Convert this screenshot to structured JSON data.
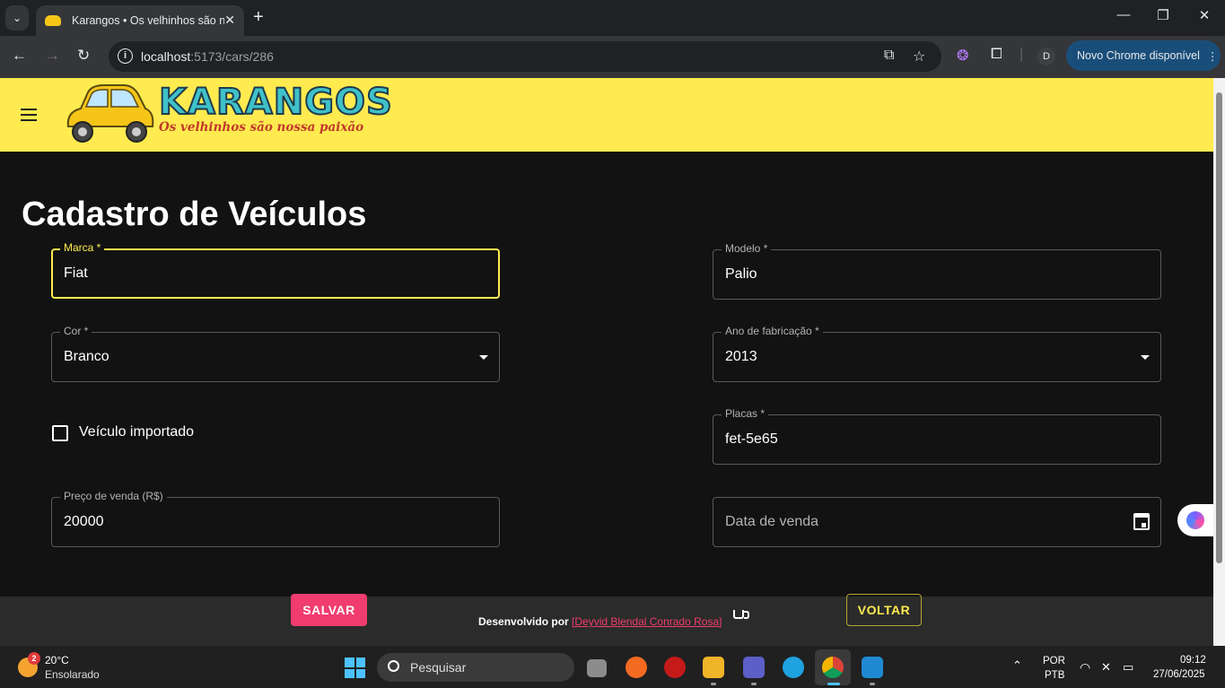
{
  "browser": {
    "tab_title": "Karangos • Os velhinhos são nossa paixão",
    "url_host": "localhost",
    "url_path": ":5173/cars/286",
    "update_label": "Novo Chrome disponível",
    "profile_initial": "D"
  },
  "app": {
    "logo_title": "KARANGOS",
    "logo_subtitle": "Os velhinhos são nossa paixão"
  },
  "form": {
    "title": "Cadastro de Veículos",
    "marca": {
      "label": "Marca *",
      "value": "Fiat"
    },
    "modelo": {
      "label": "Modelo *",
      "value": "Palio"
    },
    "cor": {
      "label": "Cor *",
      "value": "Branco"
    },
    "ano": {
      "label": "Ano de fabricação *",
      "value": "2013"
    },
    "importado": {
      "label": "Veículo importado",
      "checked": false
    },
    "placas": {
      "label": "Placas *",
      "value": "fet-5e65"
    },
    "preco": {
      "label": "Preço de venda (R$)",
      "value": "20000"
    },
    "data_venda": {
      "placeholder": "Data de venda"
    },
    "save_label": "SALVAR",
    "back_label": "VOLTAR"
  },
  "footer": {
    "credit_prefix": "Desenvolvido por",
    "credit_link": "[Deyvid Blendal Conrado Rosa]"
  },
  "taskbar": {
    "temperature": "20°C",
    "weather": "Ensolarado",
    "weather_badge": "2",
    "search_placeholder": "Pesquisar",
    "lang_top": "POR",
    "lang_bottom": "PTB",
    "time": "09:12",
    "date": "27/06/2025"
  },
  "colors": {
    "appbar": "#ffeb4f",
    "primary_button": "#f03c6e",
    "background": "#121212"
  }
}
